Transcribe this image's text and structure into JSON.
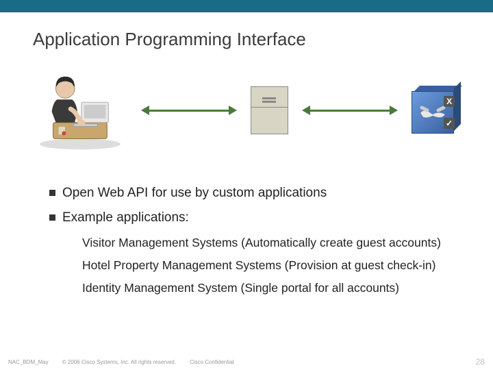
{
  "title": "Application Programming Interface",
  "bullets": {
    "b1": "Open Web API for use by custom applications",
    "b2": "Example applications:"
  },
  "subs": {
    "s1": "Visitor Management Systems (Automatically create guest accounts)",
    "s2": "Hotel Property Management Systems (Provision at guest check-in)",
    "s3": "Identity Management System (Single portal for all accounts)"
  },
  "cube": {
    "x": "X",
    "check": "✓"
  },
  "footer": {
    "doc_id": "NAC_BDM_May",
    "copyright": "© 2006 Cisco Systems, Inc. All rights reserved.",
    "confidential": "Cisco Confidential",
    "page": "28"
  }
}
